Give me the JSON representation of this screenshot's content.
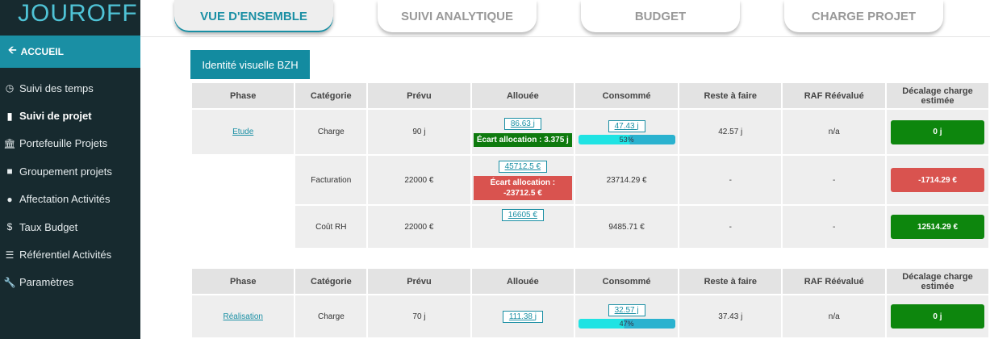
{
  "app": {
    "brand": "JOUROFF"
  },
  "sidebar": {
    "home_label": "ACCUEIL",
    "items": [
      {
        "label": "Suivi des temps",
        "icon": "clock-icon"
      },
      {
        "label": "Suivi de projet",
        "icon": "bar-chart-icon"
      },
      {
        "label": "Portefeuille Projets",
        "icon": "bank-icon"
      },
      {
        "label": "Groupement projets",
        "icon": "folder-icon"
      },
      {
        "label": "Affectation Activités",
        "icon": "users-icon"
      },
      {
        "label": "Taux Budget",
        "icon": "dollar-icon"
      },
      {
        "label": "Référentiel Activités",
        "icon": "list-icon"
      },
      {
        "label": "Paramètres",
        "icon": "wrench-icon"
      }
    ]
  },
  "tabs": [
    {
      "label": "VUE D'ENSEMBLE",
      "active": true
    },
    {
      "label": "SUIVI ANALYTIQUE",
      "active": false
    },
    {
      "label": "BUDGET",
      "active": false
    },
    {
      "label": "CHARGE PROJET",
      "active": false
    }
  ],
  "project": {
    "title": "Identité visuelle BZH"
  },
  "table": {
    "headers": [
      "Phase",
      "Catégorie",
      "Prévu",
      "Allouée",
      "Consommé",
      "Reste à faire",
      "RAF Réévalué",
      "Décalage charge estimée"
    ]
  },
  "phase1": {
    "name": "Etude",
    "rows": [
      {
        "category": "Charge",
        "prevu": "90 j",
        "allouee": "86.63 j",
        "ecart": "Écart allocation : 3.375 j",
        "consomme": "47.43 j",
        "consomme_pct": "53%",
        "consomme_fraction": 0.53,
        "raf": "42.57 j",
        "raf_reevalue": "n/a",
        "decalage": "0 j"
      },
      {
        "category": "Facturation",
        "prevu": "22000 €",
        "allouee": "45712.5 €",
        "ecart": "Écart allocation : -23712.5 €",
        "consomme": "23714.29 €",
        "raf": "-",
        "raf_reevalue": "-",
        "decalage": "-1714.29 €"
      },
      {
        "category": "Coût RH",
        "prevu": "22000 €",
        "allouee": "16605 €",
        "consomme": "9485.71 €",
        "raf": "-",
        "raf_reevalue": "-",
        "decalage": "12514.29 €"
      }
    ]
  },
  "phase2": {
    "name": "Réalisation",
    "rows": [
      {
        "category": "Charge",
        "prevu": "70 j",
        "allouee": "111.38 j",
        "consomme": "32.57 j",
        "consomme_pct": "47%",
        "consomme_fraction": 0.47,
        "raf": "37.43 j",
        "raf_reevalue": "n/a",
        "decalage": "0 j"
      }
    ]
  },
  "colors": {
    "accent": "#1a8fa4",
    "sidebar": "#172a2f",
    "ok": "#0d860d",
    "ko": "#d9534f"
  }
}
